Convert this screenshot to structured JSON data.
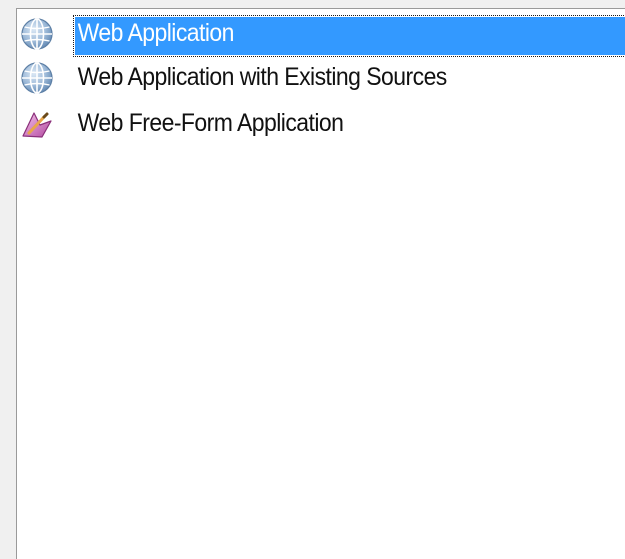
{
  "project_list": {
    "items": [
      {
        "label": "Web Application",
        "icon": "globe-icon",
        "selected": true
      },
      {
        "label": "Web Application with Existing Sources",
        "icon": "globe-icon",
        "selected": false
      },
      {
        "label": "Web Free-Form Application",
        "icon": "freeform-app-icon",
        "selected": false
      }
    ]
  },
  "colors": {
    "selection_background": "#3399ff",
    "panel_background": "#ffffff",
    "window_background": "#f0f0f0",
    "globe_icon_blue": "#7ea6cf",
    "freeform_icon_pink": "#c75bb7"
  }
}
